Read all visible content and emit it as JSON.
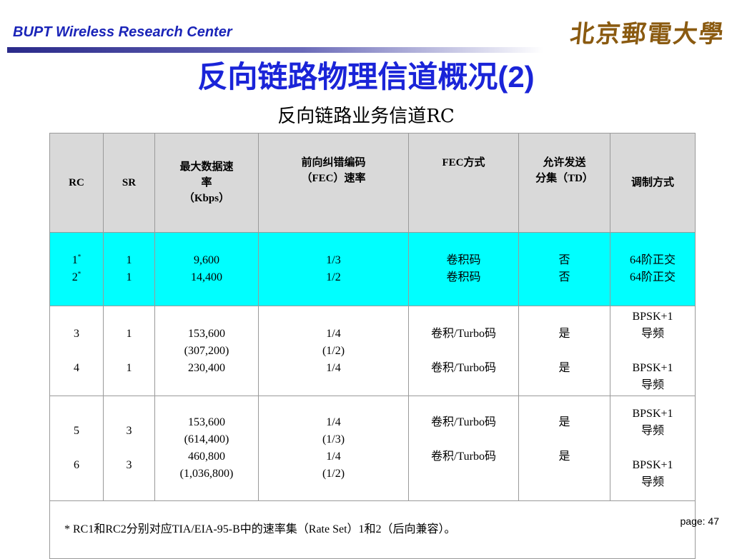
{
  "header": {
    "org": "BUPT Wireless Research Center",
    "logo_text": "北京郵電大學"
  },
  "title": {
    "main": "反向链路物理信道概况",
    "suffix": "(2)",
    "sub": "反向链路业务信道RC"
  },
  "table": {
    "headers": {
      "rc": "RC",
      "sr": "SR",
      "max_rate_l1": "最大数据速",
      "max_rate_l2": "率",
      "max_rate_l3": "（Kbps）",
      "fec_rate_l1": "前向纠错编码",
      "fec_rate_l2": "（FEC）速率",
      "fec_type": "FEC方式",
      "td_l1": "允许发送",
      "td_l2": "分集（TD）",
      "modulation": "调制方式"
    },
    "rows": {
      "r12": {
        "rc1": "1",
        "rc2": "2",
        "star": "*",
        "sr1": "1",
        "sr2": "1",
        "rate1": "9,600",
        "rate2": "14,400",
        "fec1": "1/3",
        "fec2": "1/2",
        "type1": "卷积码",
        "type2": "卷积码",
        "td1": "否",
        "td2": "否",
        "mod1": "64阶正交",
        "mod2": "64阶正交"
      },
      "r34": {
        "rc3": "3",
        "rc4": "4",
        "sr3": "1",
        "sr4": "1",
        "rate3a": "153,600",
        "rate3b": "(307,200)",
        "rate4": "230,400",
        "fec3a": "1/4",
        "fec3b": "(1/2)",
        "fec4": "1/4",
        "type3": "卷积/Turbo码",
        "type4": "卷积/Turbo码",
        "td3": "是",
        "td4": "是",
        "mod3a": "BPSK+1",
        "mod3b": "导频",
        "mod4a": "BPSK+1",
        "mod4b": "导频"
      },
      "r56": {
        "rc5": "5",
        "rc6": "6",
        "sr5": "3",
        "sr6": "3",
        "rate5a": "153,600",
        "rate5b": "(614,400)",
        "rate6a": "460,800",
        "rate6b": "(1,036,800)",
        "fec5a": "1/4",
        "fec5b": "(1/3)",
        "fec6a": "1/4",
        "fec6b": "(1/2)",
        "type5": "卷积/Turbo码",
        "type6": "卷积/Turbo码",
        "td5": "是",
        "td6": "是",
        "mod5a": "BPSK+1",
        "mod5b": "导频",
        "mod6a": "BPSK+1",
        "mod6b": "导频"
      }
    },
    "footnote": "*  RC1和RC2分别对应TIA/EIA-95-B中的速率集（Rate Set）1和2（后向兼容）。"
  },
  "page_label": "page: 47",
  "colors": {
    "header_blue": "#1a24b8",
    "title_blue": "#1a24d8",
    "highlight_cyan": "#00ffff",
    "header_gray": "#d9d9d9",
    "logo_brown": "#8a5a10"
  }
}
